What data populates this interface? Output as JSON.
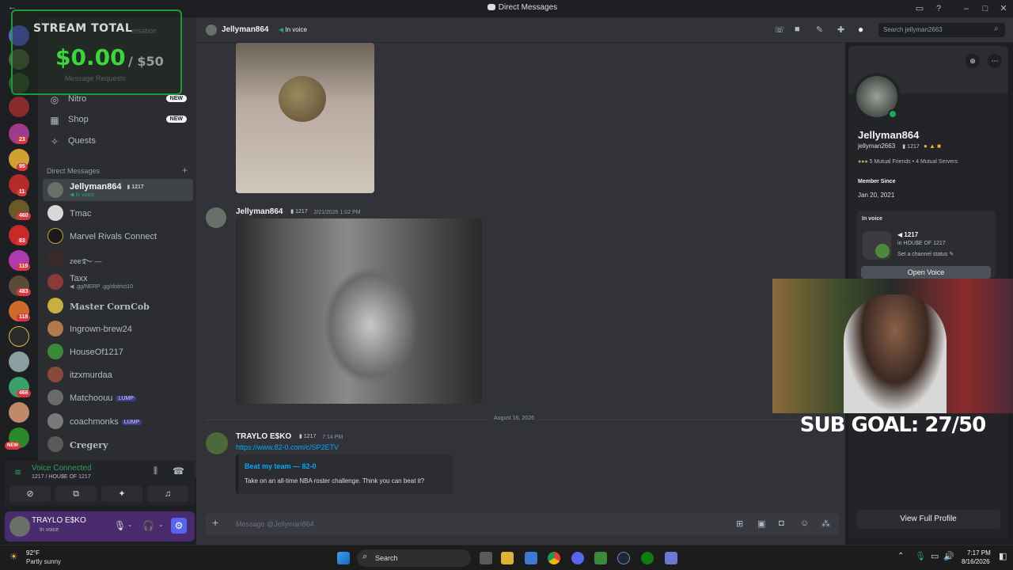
{
  "window": {
    "title": "Direct Messages"
  },
  "overlay": {
    "stream_total_label": "STREAM TOTAL",
    "stream_total_amount": "$0.00",
    "stream_total_goal": "/ $50",
    "sub_goal": "SUB GOAL: 27/50",
    "behind_text_1": "ersation",
    "behind_text_2": "Message Requests"
  },
  "servers": {
    "badges": [
      "23",
      "95",
      "11",
      "460",
      "83",
      "119",
      "483",
      "118",
      "466",
      "NEW"
    ]
  },
  "sidebar": {
    "nav": [
      {
        "label": "Nitro",
        "badge": "NEW"
      },
      {
        "label": "Shop",
        "badge": "NEW"
      },
      {
        "label": "Quests",
        "badge": ""
      }
    ],
    "dm_header": "Direct Messages",
    "dm_add": "+",
    "dms": [
      {
        "name": "Jellyman864",
        "tag": "1217",
        "sub": "In voice",
        "active": true
      },
      {
        "name": "Tmac",
        "tag": "",
        "sub": ""
      },
      {
        "name": "Marvel Rivals Connect",
        "tag": "",
        "sub": ""
      },
      {
        "name": "zee࿐ —",
        "tag": "",
        "sub": ""
      },
      {
        "name": "Taxx",
        "tag": "",
        "sub": ".gg/NERP .gg/district10"
      },
      {
        "name": "Master CornCob",
        "tag": "",
        "sub": ""
      },
      {
        "name": "Ingrown-brew24",
        "tag": "",
        "sub": ""
      },
      {
        "name": "HouseOf1217",
        "tag": "",
        "sub": ""
      },
      {
        "name": "itzxmurdaa",
        "tag": "",
        "sub": ""
      },
      {
        "name": "Matchoouu",
        "tag": "LUMP",
        "sub": ""
      },
      {
        "name": "coachmonks",
        "tag": "LUMP",
        "sub": ""
      },
      {
        "name": "Cregery",
        "tag": "",
        "sub": ""
      }
    ],
    "voice": {
      "status": "Voice Connected",
      "channel": "1217 / HOU$E OF 1217"
    },
    "user": {
      "name": "TRAYLO E$KO",
      "status": "In voice"
    }
  },
  "header": {
    "name": "Jellyman864",
    "status": "In voice",
    "search_placeholder": "Search jellyman2663"
  },
  "chat": {
    "messages": [
      {
        "author": "Jellyman864",
        "tag": "1217",
        "time": "2/21/2026 1:02 PM"
      },
      {
        "author": "TRAYLO E$KO",
        "tag": "1217",
        "time": "7:14 PM",
        "link": "https://www.82-0.com/c/SP2ETV",
        "embed_title": "Beat my team — 82-0",
        "embed_desc": "Take on an all-time NBA roster challenge. Think you can beat it?"
      }
    ],
    "date_divider": "August 16, 2026",
    "input_placeholder": "Message @Jellyman864"
  },
  "profile": {
    "display_name": "Jellyman864",
    "username": "jellyman2663",
    "tag": "1217",
    "mutual_friends": "5 Mutual Friends",
    "mutual_servers": "4 Mutual Servers",
    "member_since_label": "Member Since",
    "member_since": "Jan 20, 2021",
    "in_voice_label": "In voice",
    "voice_channel": "1217",
    "voice_server": "in HOU$E OF 1217",
    "voice_status": "Set a channel status",
    "open_voice": "Open Voice",
    "view_full_profile": "View Full Profile"
  },
  "taskbar": {
    "weather_temp": "92°F",
    "weather_desc": "Partly sunny",
    "search_label": "Search",
    "time": "7:17 PM",
    "date": "8/16/2026"
  },
  "colors": {
    "green": "#23a55a",
    "accent": "#5865f2",
    "link": "#00a8fc"
  }
}
